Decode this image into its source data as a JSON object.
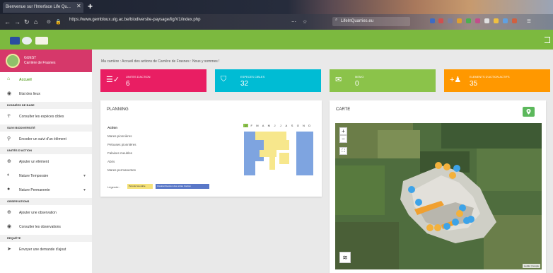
{
  "browser": {
    "tab_title": "Bienvenue sur l'Interface Life Qu...",
    "url": "https://www.gembloux.ulg.ac.be/biodiversite-paysage/lig/V1/index.php",
    "search_text": "LifeInQuarries.eu"
  },
  "sidebar": {
    "user_name": "GUEST",
    "site_name": "Carrière de Frasnes",
    "items": [
      {
        "type": "link",
        "label": "Accueil",
        "icon": "home-icon",
        "active": true
      },
      {
        "type": "link",
        "label": "Etat des lieux",
        "icon": "eye-icon"
      },
      {
        "type": "section",
        "label": "DONNÉES DE BASE"
      },
      {
        "type": "link",
        "label": "Consulter les espèces cibles",
        "icon": "species-icon"
      },
      {
        "type": "section",
        "label": "SUIVI BIODIVERSITÉ"
      },
      {
        "type": "link",
        "label": "Encoder un suivi d'un élément",
        "icon": "walker-icon"
      },
      {
        "type": "section",
        "label": "UNITÉS D'ACTION"
      },
      {
        "type": "link",
        "label": "Ajouter un élément",
        "icon": "plus-circle-icon"
      },
      {
        "type": "link",
        "label": "Nature Temporaire",
        "icon": "half-circle-icon",
        "caret": true
      },
      {
        "type": "link",
        "label": "Nature Permanente",
        "icon": "circle-icon",
        "caret": true
      },
      {
        "type": "section",
        "label": "OBSERVATIONS"
      },
      {
        "type": "link",
        "label": "Ajouter une observation",
        "icon": "plus-circle-icon"
      },
      {
        "type": "link",
        "label": "Consulter les observations",
        "icon": "eye-icon"
      },
      {
        "type": "section",
        "label": "REQUÊTE"
      },
      {
        "type": "link",
        "label": "Envoyer une demande d'ajout",
        "icon": "send-icon"
      }
    ]
  },
  "breadcrumb": "Ma carrière : Accueil des actions de Carrière de Frasnes : Nous y sommes !",
  "cards": [
    {
      "label": "UNITES D'ACTION",
      "value": "6",
      "color": "#e91e63",
      "icon": "checklist-icon"
    },
    {
      "label": "ESPECES CIBLES",
      "value": "32",
      "color": "#00bcd4",
      "icon": "shield-icon"
    },
    {
      "label": "MEMO",
      "value": "0",
      "color": "#8bc34a",
      "icon": "chat-icon"
    },
    {
      "label": "ELEMENTS D'ACTION ACTIFS",
      "value": "35",
      "color": "#ff9800",
      "icon": "add-person-icon"
    }
  ],
  "planning": {
    "title": "PLANNING",
    "header": "Action",
    "actions": [
      "Mares pionnières",
      "Pelouses pionnières",
      "Falaises meubles",
      "Abris",
      "Mares permanentes"
    ],
    "months": [
      "J",
      "F",
      "M",
      "A",
      "M",
      "J",
      "J",
      "A",
      "S",
      "O",
      "N",
      "D"
    ],
    "legend_label": "Légende :",
    "legend_items": [
      {
        "label": "Période favorable",
        "color": "#f5e27a"
      },
      {
        "label": "Création/Gestion des unités d'action",
        "color": "#5a78c8"
      }
    ]
  },
  "carte": {
    "title": "CARTE",
    "zoom_in": "+",
    "zoom_out": "−",
    "attribution": "Leaflet | Google"
  },
  "colors": {
    "header_green": "#7cb93f",
    "profile_pink": "#d6386a",
    "active_green": "#5ca12a",
    "plan_yellow": "#f7e78c",
    "plan_blue": "#7ea4e0"
  }
}
